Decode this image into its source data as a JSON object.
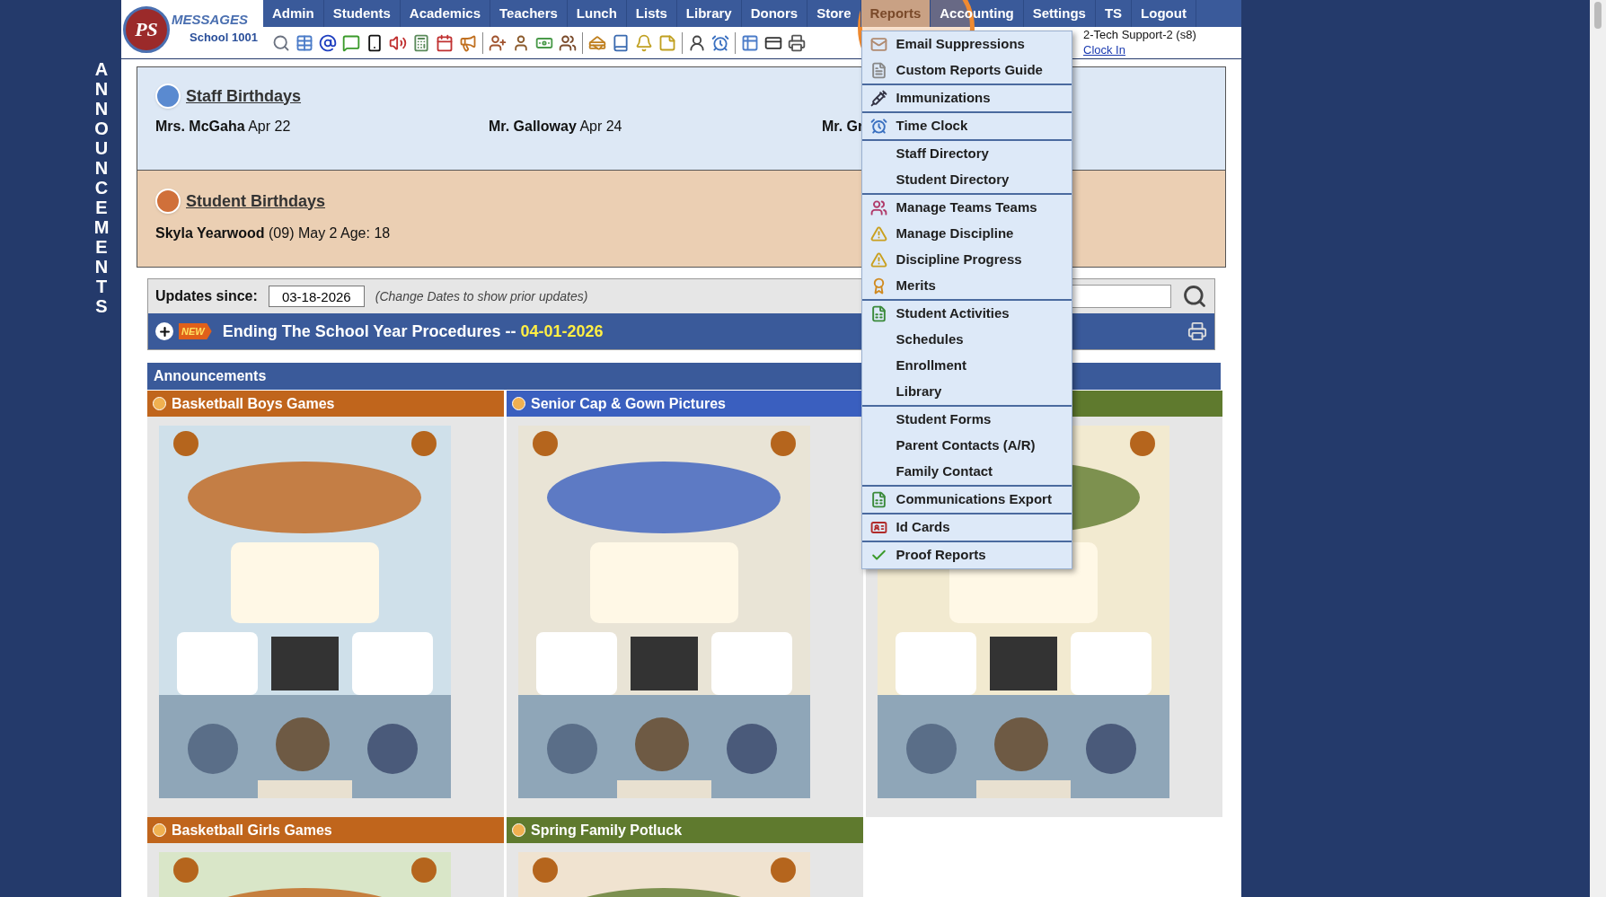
{
  "logo": {
    "letters": "PS",
    "title": "MESSAGES",
    "school": "School 1001"
  },
  "nav": [
    {
      "label": "Admin",
      "selected": false
    },
    {
      "label": "Students",
      "selected": false
    },
    {
      "label": "Academics",
      "selected": false
    },
    {
      "label": "Teachers",
      "selected": false
    },
    {
      "label": "Lunch",
      "selected": false
    },
    {
      "label": "Lists",
      "selected": false
    },
    {
      "label": "Library",
      "selected": false
    },
    {
      "label": "Donors",
      "selected": false
    },
    {
      "label": "Store",
      "selected": false
    },
    {
      "label": "Reports",
      "selected": true
    },
    {
      "label": "Accounting",
      "selected": false
    },
    {
      "label": "Settings",
      "selected": false
    },
    {
      "label": "TS",
      "selected": false
    },
    {
      "label": "Logout",
      "selected": false
    }
  ],
  "reports_menu": {
    "groups": [
      {
        "items": [
          {
            "label": "Email Suppressions",
            "kind": "envelope"
          },
          {
            "label": "Custom Reports Guide",
            "kind": "document"
          }
        ]
      },
      {
        "items": [
          {
            "label": "Immunizations",
            "kind": "syringe"
          }
        ]
      },
      {
        "items": [
          {
            "label": "Time Clock",
            "kind": "clock"
          }
        ]
      },
      {
        "items": [
          {
            "label": "Staff Directory",
            "kind": "plain"
          },
          {
            "label": "Student Directory",
            "kind": "plain"
          }
        ]
      },
      {
        "items": [
          {
            "label": "Manage Teams Teams",
            "kind": "people"
          },
          {
            "label": "Manage Discipline",
            "kind": "warning"
          },
          {
            "label": "Discipline Progress",
            "kind": "warning"
          },
          {
            "label": "Merits",
            "kind": "medal"
          }
        ]
      },
      {
        "items": [
          {
            "label": "Student Activities",
            "kind": "spreadsheet"
          },
          {
            "label": "Schedules",
            "kind": "plain"
          },
          {
            "label": "Enrollment",
            "kind": "plain"
          },
          {
            "label": "Library",
            "kind": "plain"
          }
        ]
      },
      {
        "items": [
          {
            "label": "Student Forms",
            "kind": "plain"
          },
          {
            "label": "Parent Contacts (A/R)",
            "kind": "plain"
          },
          {
            "label": "Family Contact",
            "kind": "plain"
          }
        ]
      },
      {
        "items": [
          {
            "label": "Communications Export",
            "kind": "spreadsheet"
          }
        ]
      },
      {
        "items": [
          {
            "label": "Id Cards",
            "kind": "idcard"
          }
        ]
      },
      {
        "items": [
          {
            "label": "Proof Reports",
            "kind": "check"
          }
        ]
      }
    ]
  },
  "user": {
    "name": "2-Tech Support-2 (s8)",
    "link": "Clock In"
  },
  "side_banner": "ANNOUNCEMENTS",
  "staff_birthdays": {
    "title": "Staff Birthdays",
    "people": [
      {
        "name": "Mrs. McGaha",
        "date": "Apr 22"
      },
      {
        "name": "Mr. Galloway",
        "date": "Apr 24"
      },
      {
        "name": "Mr. Gr"
      }
    ]
  },
  "student_birthdays": {
    "title": "Student Birthdays",
    "people": [
      {
        "name": "Skyla Yearwood",
        "details": "(09) May 2 Age: 18"
      }
    ]
  },
  "updates": {
    "label": "Updates since:",
    "date": "03-18-2026",
    "hint": "(Change Dates to show prior updates)"
  },
  "news": {
    "badge": "NEW",
    "title": "Ending The School Year Procedures --",
    "date": "04-01-2026"
  },
  "announcements": {
    "title": "Announcements",
    "cards": [
      {
        "title": "Basketball Boys Games",
        "color": "#c0651c"
      },
      {
        "title": "Senior Cap & Gown Pictures",
        "color": "#3a5fbf"
      },
      {
        "color": "#5f7a2e"
      },
      {
        "title": "Basketball Girls Games",
        "color": "#c0651c"
      },
      {
        "title": "Spring Family Potluck",
        "color": "#5f7a2e"
      }
    ]
  }
}
